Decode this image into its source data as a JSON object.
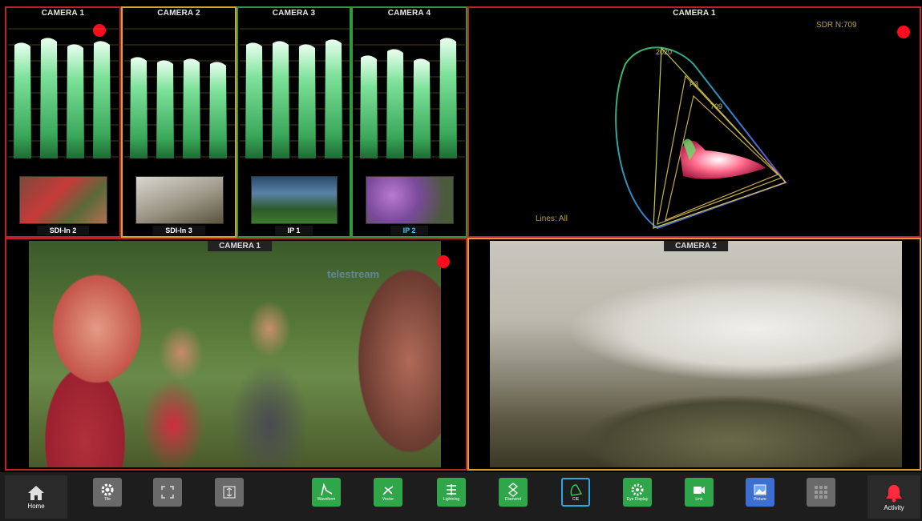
{
  "waveforms": [
    {
      "title": "CAMERA 1",
      "source": "SDI-In 2",
      "border": "#c0202a",
      "label_color": "#ffffff"
    },
    {
      "title": "CAMERA 2",
      "source": "SDI-In 3",
      "border": "#d8a22a",
      "label_color": "#ffffff"
    },
    {
      "title": "CAMERA 3",
      "source": "IP 1",
      "border": "#2c9a3c",
      "label_color": "#ffffff"
    },
    {
      "title": "CAMERA 4",
      "source": "IP 2",
      "border": "#2c9a3c",
      "label_color": "#3cc8f0"
    }
  ],
  "gamut": {
    "title": "CAMERA 1",
    "mode": "SDR N:709",
    "lines": "Lines: All",
    "labels": [
      "2020",
      "P3",
      "709"
    ],
    "border": "#c0202a"
  },
  "views": [
    {
      "title": "CAMERA 1",
      "border": "#c0202a",
      "watermark": "telestream"
    },
    {
      "title": "CAMERA 2",
      "border": "#d8a22a"
    }
  ],
  "toolbar": {
    "home": "Home",
    "activity": "Activity",
    "buttons": [
      {
        "label": "Tile",
        "icon": "gear-icon",
        "style": "gray"
      },
      {
        "label": "",
        "icon": "expand-icon",
        "style": "gray"
      },
      {
        "label": "",
        "icon": "fit-icon",
        "style": "gray"
      },
      {
        "label": "Waveform",
        "icon": "waveform-icon",
        "style": "green"
      },
      {
        "label": "Vector",
        "icon": "vector-icon",
        "style": "green"
      },
      {
        "label": "Lightning",
        "icon": "lightning-icon",
        "style": "green"
      },
      {
        "label": "Diamond",
        "icon": "diamond-icon",
        "style": "green"
      },
      {
        "label": "CIE",
        "icon": "cie-icon",
        "style": "green-outline"
      },
      {
        "label": "Eye Display",
        "icon": "eye-icon",
        "style": "green"
      },
      {
        "label": "Link",
        "icon": "camera-icon",
        "style": "green"
      },
      {
        "label": "Picture",
        "icon": "picture-icon",
        "style": "blue"
      },
      {
        "label": "",
        "icon": "grid-icon",
        "style": "gray"
      }
    ]
  },
  "colors": {
    "record": "#ff0a1f",
    "toolbar_bg": "#1d1d1d",
    "trace": "#7ee29a"
  }
}
